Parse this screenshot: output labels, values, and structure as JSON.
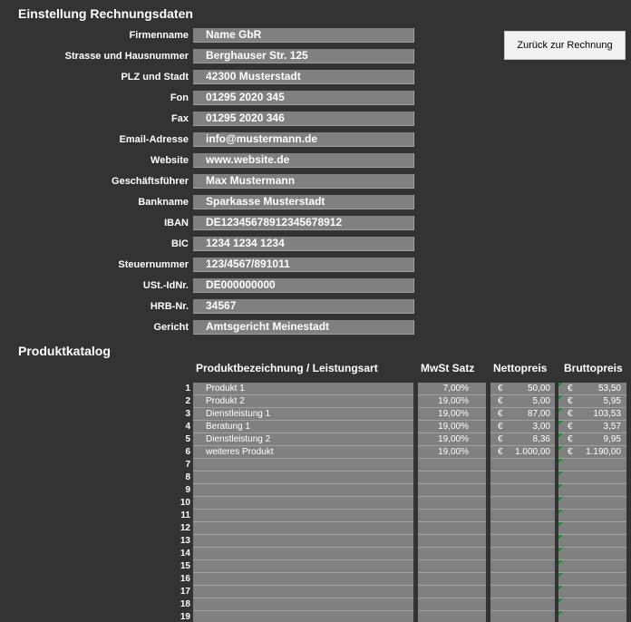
{
  "settings": {
    "title": "Einstellung Rechnungsdaten",
    "back_button": "Zurück zur Rechnung",
    "fields": [
      {
        "label": "Firmenname",
        "value": "Name GbR"
      },
      {
        "label": "Strasse und Hausnummer",
        "value": "Berghauser Str. 125"
      },
      {
        "label": "PLZ und Stadt",
        "value": "42300 Musterstadt"
      },
      {
        "label": "Fon",
        "value": "01295 2020 345"
      },
      {
        "label": "Fax",
        "value": "01295 2020 346"
      },
      {
        "label": "Email-Adresse",
        "value": "info@mustermann.de"
      },
      {
        "label": "Website",
        "value": "www.website.de"
      },
      {
        "label": "Geschäftsführer",
        "value": "Max Mustermann"
      },
      {
        "label": "Bankname",
        "value": "Sparkasse Musterstadt"
      },
      {
        "label": "IBAN",
        "value": "DE12345678912345678912"
      },
      {
        "label": "BIC",
        "value": "1234 1234 1234"
      },
      {
        "label": "Steuernummer",
        "value": "123/4567/891011"
      },
      {
        "label": "USt.-IdNr.",
        "value": "DE000000000"
      },
      {
        "label": "HRB-Nr.",
        "value": "34567"
      },
      {
        "label": "Gericht",
        "value": "Amtsgericht Meinestadt"
      }
    ]
  },
  "catalog": {
    "title": "Produktkatalog",
    "columns": {
      "name": "Produktbezeichnung / Leistungsart",
      "vat": "MwSt Satz",
      "net": "Nettopreis",
      "gross": "Bruttopreis"
    },
    "currency": "€",
    "rows": [
      {
        "num": "1",
        "name": "Produkt 1",
        "vat": "7,00%",
        "net": "50,00",
        "gross": "53,50"
      },
      {
        "num": "2",
        "name": "Produkt 2",
        "vat": "19,00%",
        "net": "5,00",
        "gross": "5,95"
      },
      {
        "num": "3",
        "name": "Dienstleistung 1",
        "vat": "19,00%",
        "net": "87,00",
        "gross": "103,53"
      },
      {
        "num": "4",
        "name": "Beratung 1",
        "vat": "19,00%",
        "net": "3,00",
        "gross": "3,57"
      },
      {
        "num": "5",
        "name": "Dienstleistung 2",
        "vat": "19,00%",
        "net": "8,36",
        "gross": "9,95"
      },
      {
        "num": "6",
        "name": "weiteres Produkt",
        "vat": "19,00%",
        "net": "1.000,00",
        "gross": "1.190,00"
      },
      {
        "num": "7",
        "name": "",
        "vat": "",
        "net": "",
        "gross": ""
      },
      {
        "num": "8",
        "name": "",
        "vat": "",
        "net": "",
        "gross": ""
      },
      {
        "num": "9",
        "name": "",
        "vat": "",
        "net": "",
        "gross": ""
      },
      {
        "num": "10",
        "name": "",
        "vat": "",
        "net": "",
        "gross": ""
      },
      {
        "num": "11",
        "name": "",
        "vat": "",
        "net": "",
        "gross": ""
      },
      {
        "num": "12",
        "name": "",
        "vat": "",
        "net": "",
        "gross": ""
      },
      {
        "num": "13",
        "name": "",
        "vat": "",
        "net": "",
        "gross": ""
      },
      {
        "num": "14",
        "name": "",
        "vat": "",
        "net": "",
        "gross": ""
      },
      {
        "num": "15",
        "name": "",
        "vat": "",
        "net": "",
        "gross": ""
      },
      {
        "num": "16",
        "name": "",
        "vat": "",
        "net": "",
        "gross": ""
      },
      {
        "num": "17",
        "name": "",
        "vat": "",
        "net": "",
        "gross": ""
      },
      {
        "num": "18",
        "name": "",
        "vat": "",
        "net": "",
        "gross": ""
      },
      {
        "num": "19",
        "name": "",
        "vat": "",
        "net": "",
        "gross": ""
      }
    ]
  },
  "colors": {
    "background": "#333333",
    "cell": "#808080",
    "error_indicator": "#2e8b3c"
  },
  "icons": {
    "formula_warning": "green-corner-triangle-icon"
  }
}
